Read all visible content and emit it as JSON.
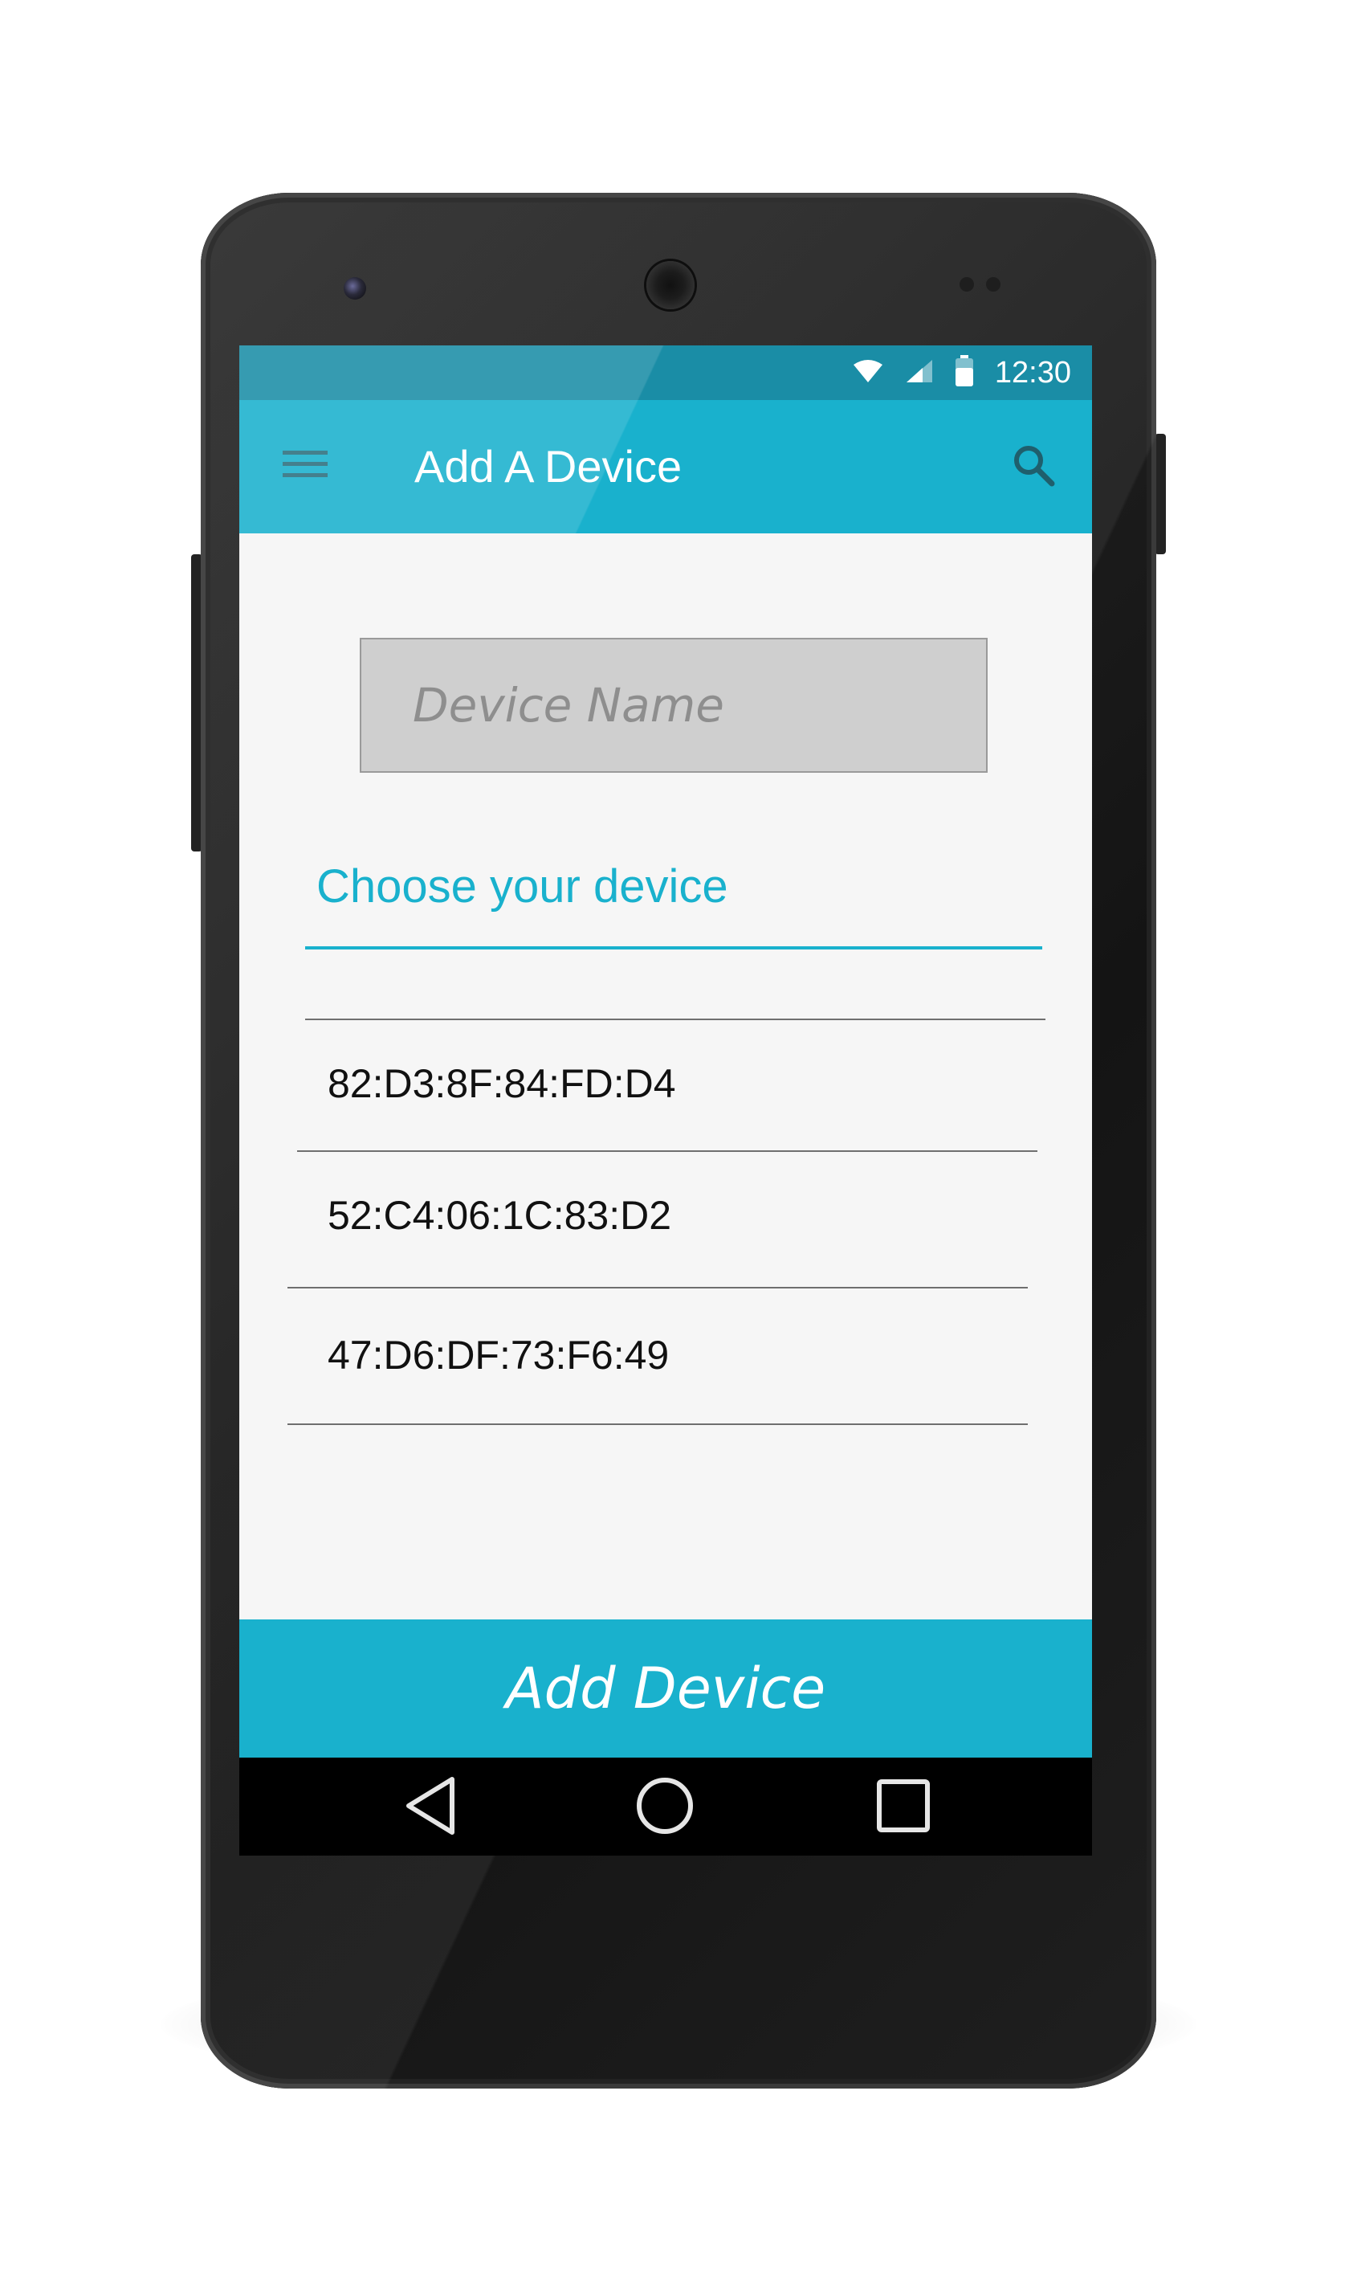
{
  "status_bar": {
    "time": "12:30",
    "icons": [
      "wifi-icon",
      "cell-signal-icon",
      "battery-icon"
    ]
  },
  "app_bar": {
    "title": "Add A Device",
    "menu_icon": "hamburger-menu-icon",
    "search_icon": "search-icon"
  },
  "form": {
    "device_name_placeholder": "Device Name",
    "device_name_value": ""
  },
  "device_list": {
    "label": "Choose your device",
    "items": [
      "82:D3:8F:84:FD:D4",
      "52:C4:06:1C:83:D2",
      "47:D6:DF:73:F6:49"
    ]
  },
  "actions": {
    "add_device_label": "Add Device"
  },
  "nav_bar": {
    "icons": [
      "back-icon",
      "home-icon",
      "recents-icon"
    ]
  },
  "colors": {
    "accent": "#19b1cd",
    "status_bar": "#1a8da6",
    "screen_background": "#f6f6f6",
    "input_background": "#cfcfcf"
  }
}
